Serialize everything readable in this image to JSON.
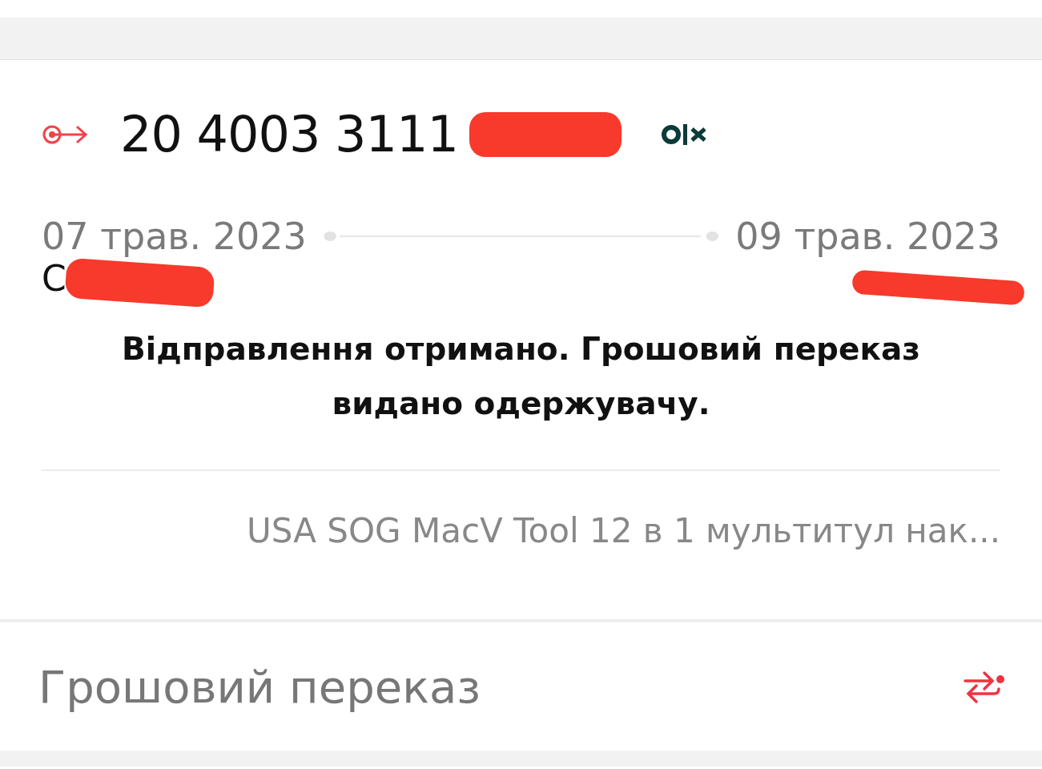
{
  "shipment": {
    "number": "20 4003 3111",
    "sent_date": "07 трав. 2023",
    "delivered_date": "09 трав. 2023",
    "from_city": "С",
    "status": "Відправлення отримано. Грошовий переказ видано одержувачу.",
    "item": "USA SOG MacV Tool 12 в 1 мультитул нак..."
  },
  "service": {
    "label": "Грошовий переказ"
  }
}
